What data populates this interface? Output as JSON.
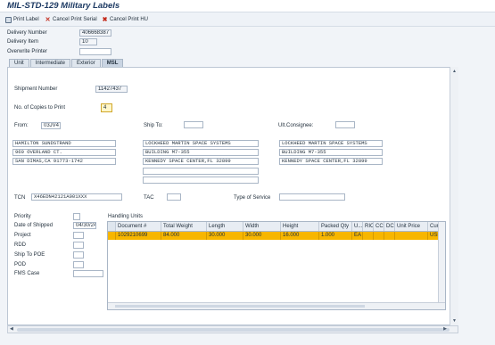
{
  "window": {
    "title": "MIL-STD-129 Military Labels"
  },
  "toolbar": {
    "print_label": "Print Label",
    "cancel_print_serial": "Cancel Print Serial",
    "cancel_print_hu": "Cancel Print HU"
  },
  "header": {
    "delivery_number_label": "Delivery Number",
    "delivery_number_value": "406668387",
    "delivery_item_label": "Delivery Item",
    "delivery_item_value": "10",
    "overwrite_printer_label": "Overwrite Printer",
    "overwrite_printer_value": ""
  },
  "tabs": [
    {
      "label": "Unit"
    },
    {
      "label": "Intermediate"
    },
    {
      "label": "Exterior"
    },
    {
      "label": "MSL"
    }
  ],
  "msl": {
    "shipment_number_label": "Shipment Number",
    "shipment_number_value": "11427437",
    "copies_label": "No. of Copies to Print",
    "copies_value": "4",
    "from_label": "From:",
    "from_code": "03JV4",
    "ship_to_label": "Ship To:",
    "ship_to_code": "",
    "ult_consignee_label": "Ult.Consignee:",
    "ult_consignee_code": "",
    "from_address": [
      "HAMILTON SUNDSTRAND",
      "960 OVERLAND CT.",
      "SAN DIMAS,CA 91773-1742"
    ],
    "ship_to_address": [
      "LOCKHEED MARTIN SPACE SYSTEMS",
      "BUILDING M7-355",
      "KENNEDY SPACE CENTER,FL 32899",
      "",
      ""
    ],
    "consignee_address": [
      "LOCKHEED MARTIN SPACE SYSTEMS",
      "BUILDING M7-355",
      "KENNEDY SPACE CENTER,FL 32899"
    ],
    "tcn_label": "TCN",
    "tcn_value": "X46EDN42121A001XXX",
    "tac_label": "TAC",
    "tac_value": "",
    "type_of_service_label": "Type of Service",
    "type_of_service_value": "",
    "priority_label": "Priority",
    "priority_value": "",
    "date_shipped_label": "Date of Shipped",
    "date_shipped_value": "04/30/24",
    "project_label": "Project",
    "project_value": "",
    "rdd_label": "RDD",
    "rdd_value": "",
    "ship_to_poe_label": "Ship To POE",
    "ship_to_poe_value": "",
    "pod_label": "POD",
    "pod_value": "",
    "fms_case_label": "FMS Case",
    "fms_case_value": ""
  },
  "handling_units": {
    "title": "Handling Units",
    "columns": [
      "Document #",
      "Total Weight",
      "Length",
      "Width",
      "Height",
      "Packed Qty",
      "U...",
      "RIC",
      "CC",
      "DC",
      "Unit Price",
      "Curr"
    ],
    "rows": [
      [
        "1029210699",
        "84.000",
        "30.000",
        "30.000",
        "16.000",
        "1.000",
        "EA",
        "",
        "",
        "",
        "",
        "USD"
      ]
    ]
  }
}
